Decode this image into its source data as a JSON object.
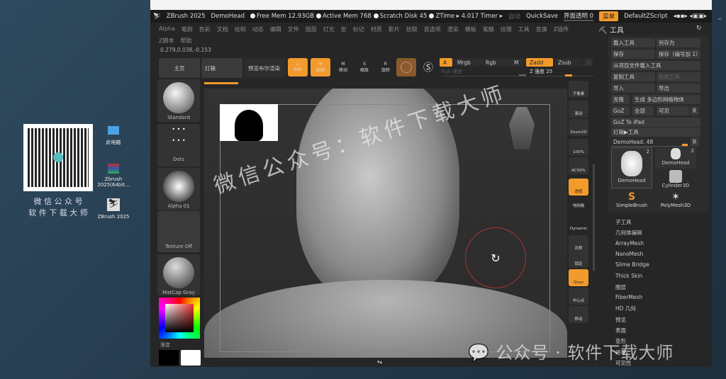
{
  "titlebar": {
    "app": "ZBrush 2025",
    "doc": "DemoHead",
    "free_mem": "Free Mem 12.93GB",
    "active_mem": "Active Mem 768",
    "scratch": "Scratch Disk 45",
    "ztime": "ZTime ▸ 4.017 Timer ▸",
    "auto": "自动",
    "quicksave": "QuickSave",
    "transparency": "界面透明 0",
    "menu": "菜单",
    "script": "DefaultZScript"
  },
  "menu": [
    "Alpha",
    "笔刷",
    "色彩",
    "文档",
    "绘制",
    "动态",
    "编辑",
    "文件",
    "图层",
    "灯光",
    "宏",
    "标记",
    "材质",
    "影片",
    "拾取",
    "首选项",
    "渲染",
    "模板",
    "笔触",
    "纹理",
    "工具",
    "变换",
    "Z插件"
  ],
  "menu2": [
    "Z脚本",
    "帮助"
  ],
  "coords": "0.279,0.038,-0.153",
  "toolbar": {
    "home": "主页",
    "lightbox": "灯箱",
    "bool": "预览布尔渲染",
    "edit": "Edit",
    "draw": "绘制",
    "move": "移动",
    "scale": "缩放",
    "rotate": "旋转",
    "a": "A",
    "mrgb": "Mrgb",
    "rgb": "Rgb",
    "m": "M",
    "zadd": "Zadd",
    "zsub": "Zsub",
    "zc": "Zc",
    "rgb_intensity": "Rgb 强度",
    "z_intensity": "Z 强度 25"
  },
  "z_intensity_value": 25,
  "left_shelf": {
    "brush": "Standard",
    "stroke": "Dots",
    "alpha": "Alpha 01",
    "texture": "Texture Off",
    "material": "MatCap Gray",
    "gradient": "渐变"
  },
  "right_shelf": [
    "子像素",
    "滚动",
    "Zoom2D",
    "100%",
    "AC50%",
    "透视",
    "地网格",
    "Dynamic",
    "对称",
    "锁定",
    "Qxyz",
    "中心点",
    "移动"
  ],
  "tool_panel": {
    "title": "工具",
    "buttons": [
      "载入工具",
      "另存为",
      "保存",
      "保存（编号加 1）",
      "从项目文件载入工具",
      "复制工具",
      "粘贴工具",
      "导入",
      "导出",
      "克隆",
      "生成 多边形网格物体",
      "GoZ",
      "全部",
      "可见",
      "R",
      "GoZ To iPad",
      "灯箱▶工具",
      "R"
    ],
    "current": "DemoHead. 48",
    "thumbs": [
      {
        "name": "DemoHead",
        "count": "2"
      },
      {
        "name": "DemoHead",
        "count": "2"
      },
      {
        "name": "Cylinder3D"
      },
      {
        "name": "SimpleBrush"
      },
      {
        "name": "PolyMesh3D"
      }
    ],
    "subpalettes": [
      "子工具",
      "几何体编辑",
      "ArrayMesh",
      "NanoMesh",
      "Slime Bridge",
      "Thick Skin",
      "图层",
      "FiberMesh",
      "HD 几何",
      "预览",
      "表面",
      "变形",
      "遮罩",
      "可见性"
    ]
  },
  "desktop": {
    "qr_caption1": "微 信 公 众 号",
    "qr_caption2": "软 件 下 载 大 师",
    "icons": [
      "此电脑",
      "Zbrush 2025(64bit...",
      "ZBrush 2025"
    ]
  },
  "watermark": {
    "diag": "微信公众号：软件下载大师",
    "bottom": "公众号 · 软件下载大师"
  },
  "colors": {
    "accent": "#f39a2c",
    "panel": "#262626"
  }
}
